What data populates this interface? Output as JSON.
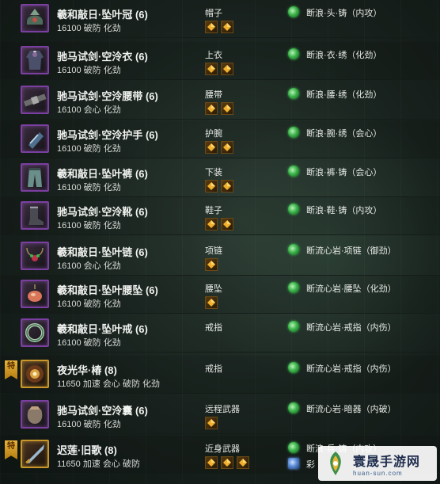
{
  "colors": {
    "epic_border": "#7a3fa0",
    "legend_border": "#c9962a",
    "jade": "#3bb34a"
  },
  "rows": [
    {
      "name": "羲和敲日·坠叶冠 (6)",
      "stats": "16100 破防 化劲",
      "slot": "帽子",
      "gems": 2,
      "skill": "断浪·头·铸（内攻）",
      "tag": "",
      "icon": "helmet-icon"
    },
    {
      "name": "驰马试剑·空泠衣 (6)",
      "stats": "16100 破防 化劲",
      "slot": "上衣",
      "gems": 2,
      "skill": "断浪·衣·绣（化劲）",
      "tag": "",
      "icon": "robe-icon"
    },
    {
      "name": "驰马试剑·空泠腰带 (6)",
      "stats": "16100 会心 化劲",
      "slot": "腰带",
      "gems": 2,
      "skill": "断浪·腰·绣（化劲）",
      "tag": "",
      "icon": "belt-icon"
    },
    {
      "name": "驰马试剑·空泠护手 (6)",
      "stats": "16100 破防 化劲",
      "slot": "护腕",
      "gems": 2,
      "skill": "断浪·腕·绣（会心）",
      "tag": "",
      "icon": "bracer-icon"
    },
    {
      "name": "羲和敲日·坠叶裤 (6)",
      "stats": "16100 破防 化劲",
      "slot": "下装",
      "gems": 2,
      "skill": "断浪·裤·铸（会心）",
      "tag": "",
      "icon": "pants-icon"
    },
    {
      "name": "驰马试剑·空泠靴 (6)",
      "stats": "16100 破防 化劲",
      "slot": "鞋子",
      "gems": 2,
      "skill": "断浪·鞋·铸（内攻）",
      "tag": "",
      "icon": "boots-icon"
    },
    {
      "name": "羲和敲日·坠叶链 (6)",
      "stats": "16100 会心 化劲",
      "slot": "项链",
      "gems": 1,
      "skill": "断流心岩·项链（御劲）",
      "tag": "",
      "icon": "necklace-icon"
    },
    {
      "name": "羲和敲日·坠叶腰坠 (6)",
      "stats": "16100 破防 化劲",
      "slot": "腰坠",
      "gems": 1,
      "skill": "断流心岩·腰坠（化劲）",
      "tag": "",
      "icon": "pendant-icon"
    },
    {
      "name": "羲和敲日·坠叶戒 (6)",
      "stats": "16100 破防 化劲",
      "slot": "戒指",
      "gems": 0,
      "skill": "断流心岩·戒指（内伤）",
      "tag": "",
      "icon": "ring-icon"
    },
    {
      "name": "夜光华·椿 (8)",
      "stats": "11650 加速 会心 破防 化劲",
      "slot": "戒指",
      "gems": 0,
      "skill": "断流心岩·戒指（内伤）",
      "tag": "特",
      "icon": "flower-ring-icon"
    },
    {
      "name": "驰马试剑·空泠囊 (6)",
      "stats": "16100 破防 化劲",
      "slot": "远程武器",
      "gems": 1,
      "skill": "断流心岩·暗器（内破）",
      "tag": "",
      "icon": "pouch-icon"
    },
    {
      "name": "迟莲·旧歌 (8)",
      "stats": "11650 加速 会心 破防",
      "slot": "近身武器",
      "gems": 3,
      "skill": "断浪·兵·铸（内攻）",
      "skill2": "彩",
      "tag": "特",
      "icon": "weapon-icon"
    }
  ],
  "watermark": {
    "title": "寰晟手游网",
    "sub": "huan-sun.com"
  }
}
